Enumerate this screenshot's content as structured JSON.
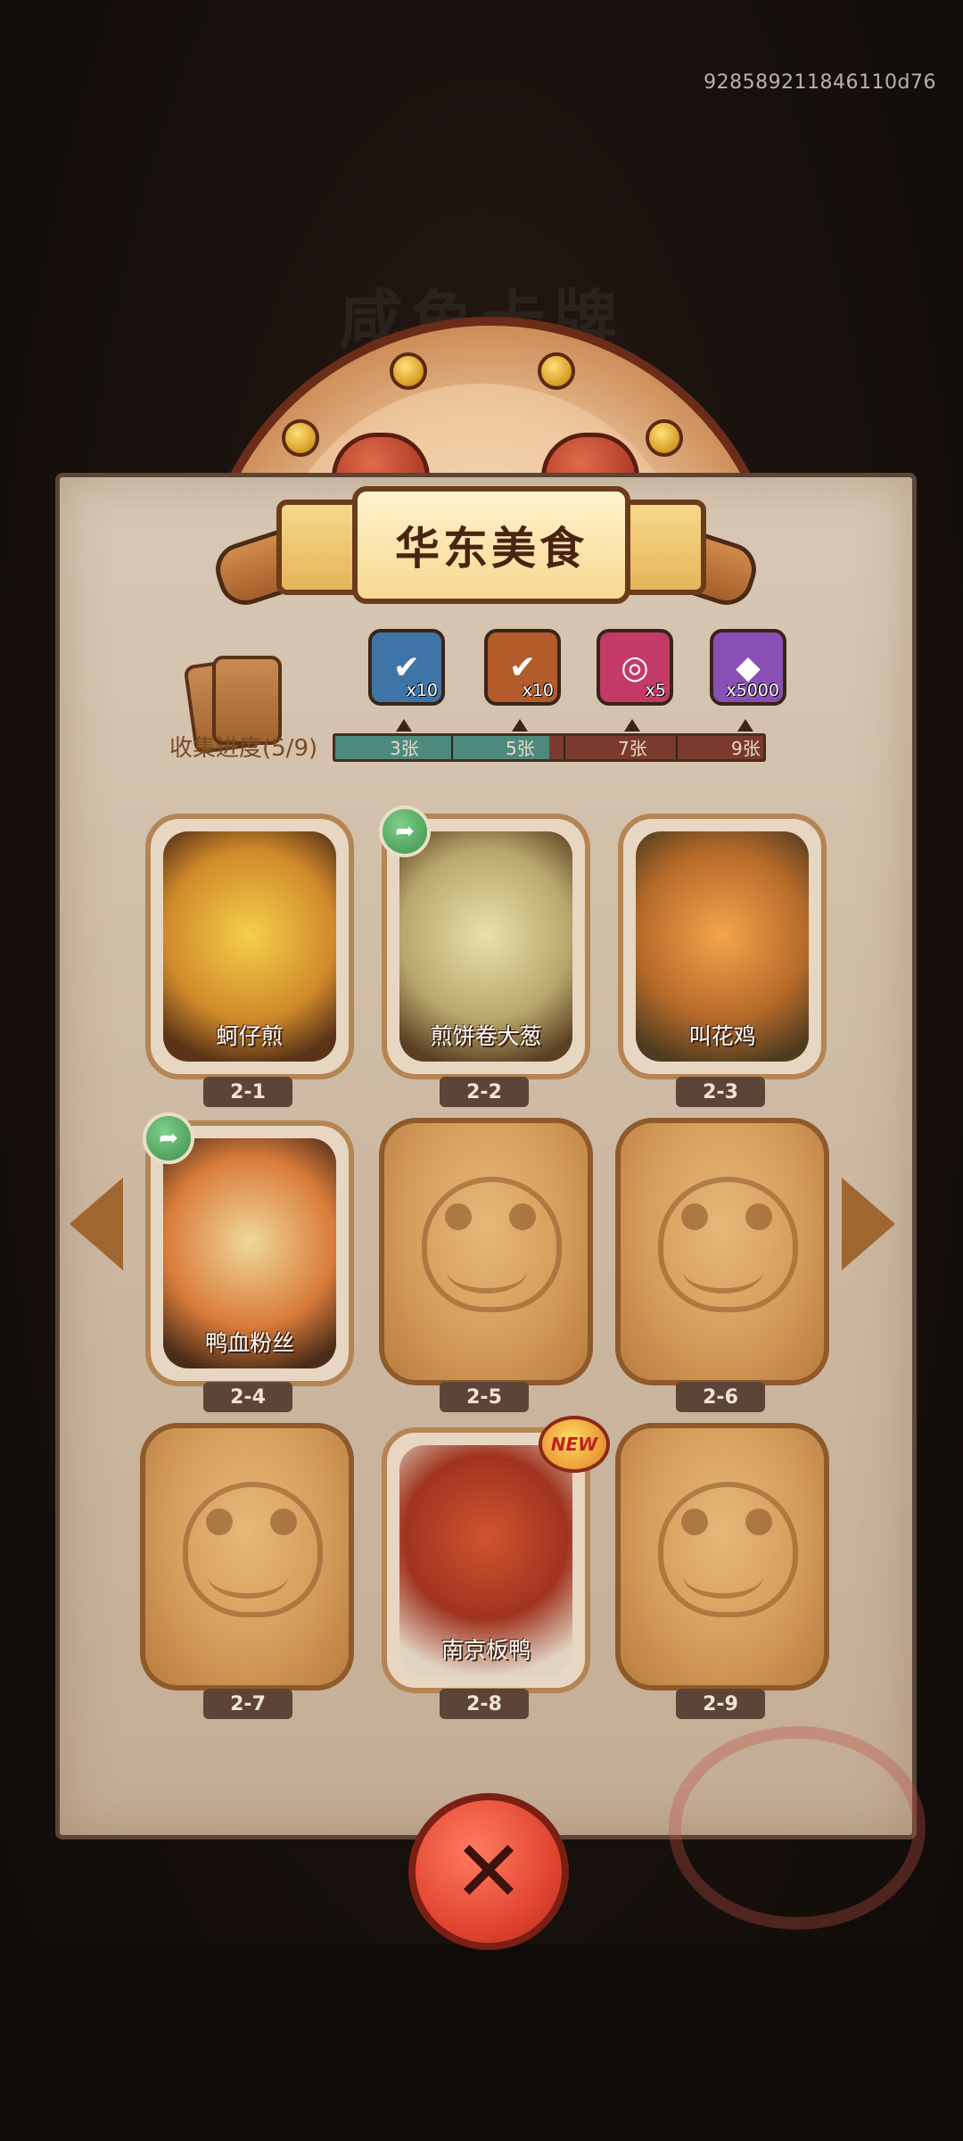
{
  "top_right_id": "928589211846110d76",
  "background_title": "咸鱼卡牌",
  "banner_title": "华东美食",
  "progress": {
    "label": "收集进度(5/9)",
    "collected": 5,
    "total": 9,
    "rewards": [
      {
        "icon": "treasure-chest-icon",
        "amount": "x10",
        "color": "#3f74a6"
      },
      {
        "icon": "key-icon",
        "amount": "x10",
        "color": "#b35b2a"
      },
      {
        "icon": "orb-icon",
        "amount": "x5",
        "color": "#c33a67"
      },
      {
        "icon": "crystal-icon",
        "amount": "x5000",
        "color": "#8a4fb5"
      }
    ],
    "milestones": [
      "3张",
      "5张",
      "7张",
      "9张"
    ]
  },
  "cards": [
    {
      "id": "2-1",
      "name": "蚵仔煎",
      "unlocked": true,
      "share": false,
      "new": false,
      "color": "#e0a63a"
    },
    {
      "id": "2-2",
      "name": "煎饼卷大葱",
      "unlocked": true,
      "share": true,
      "new": false,
      "color": "#c8b67a"
    },
    {
      "id": "2-3",
      "name": "叫花鸡",
      "unlocked": true,
      "share": false,
      "new": false,
      "color": "#d38a38"
    },
    {
      "id": "2-4",
      "name": "鸭血粉丝",
      "unlocked": true,
      "share": true,
      "new": false,
      "color": "#c8703a"
    },
    {
      "id": "2-5",
      "name": "",
      "unlocked": false,
      "share": false,
      "new": false
    },
    {
      "id": "2-6",
      "name": "",
      "unlocked": false,
      "share": false,
      "new": false
    },
    {
      "id": "2-7",
      "name": "",
      "unlocked": false,
      "share": false,
      "new": false
    },
    {
      "id": "2-8",
      "name": "南京板鸭",
      "unlocked": true,
      "share": false,
      "new": true,
      "color": "#b2402a"
    },
    {
      "id": "2-9",
      "name": "",
      "unlocked": false,
      "share": false,
      "new": false
    }
  ],
  "new_label": "NEW"
}
